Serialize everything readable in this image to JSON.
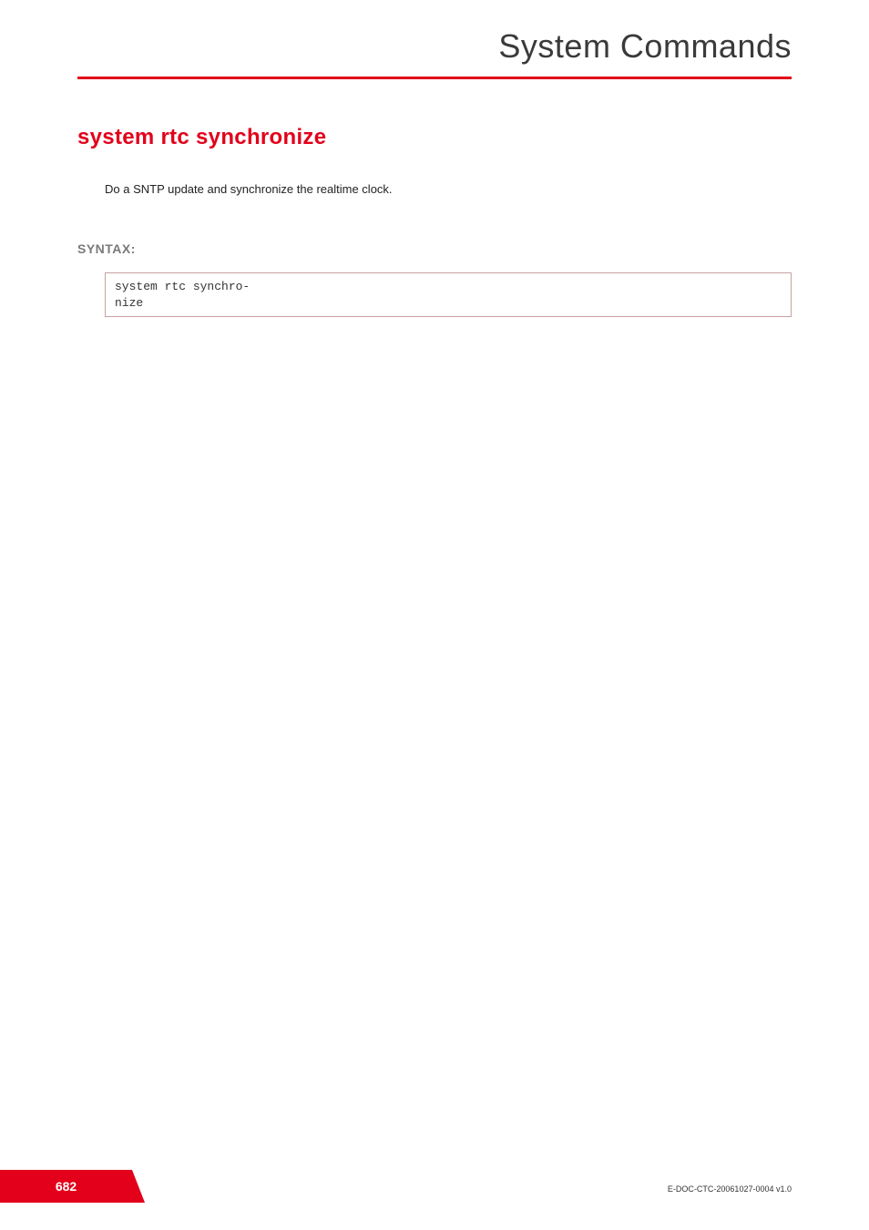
{
  "header": {
    "chapter_title": "System Commands"
  },
  "command": {
    "title": "system rtc synchronize",
    "description": "Do a SNTP update and synchronize the realtime clock."
  },
  "syntax": {
    "label": "SYNTAX:",
    "code": "system rtc synchro-\nnize"
  },
  "footer": {
    "page_number": "682",
    "doc_id": "E-DOC-CTC-20061027-0004 v1.0"
  }
}
